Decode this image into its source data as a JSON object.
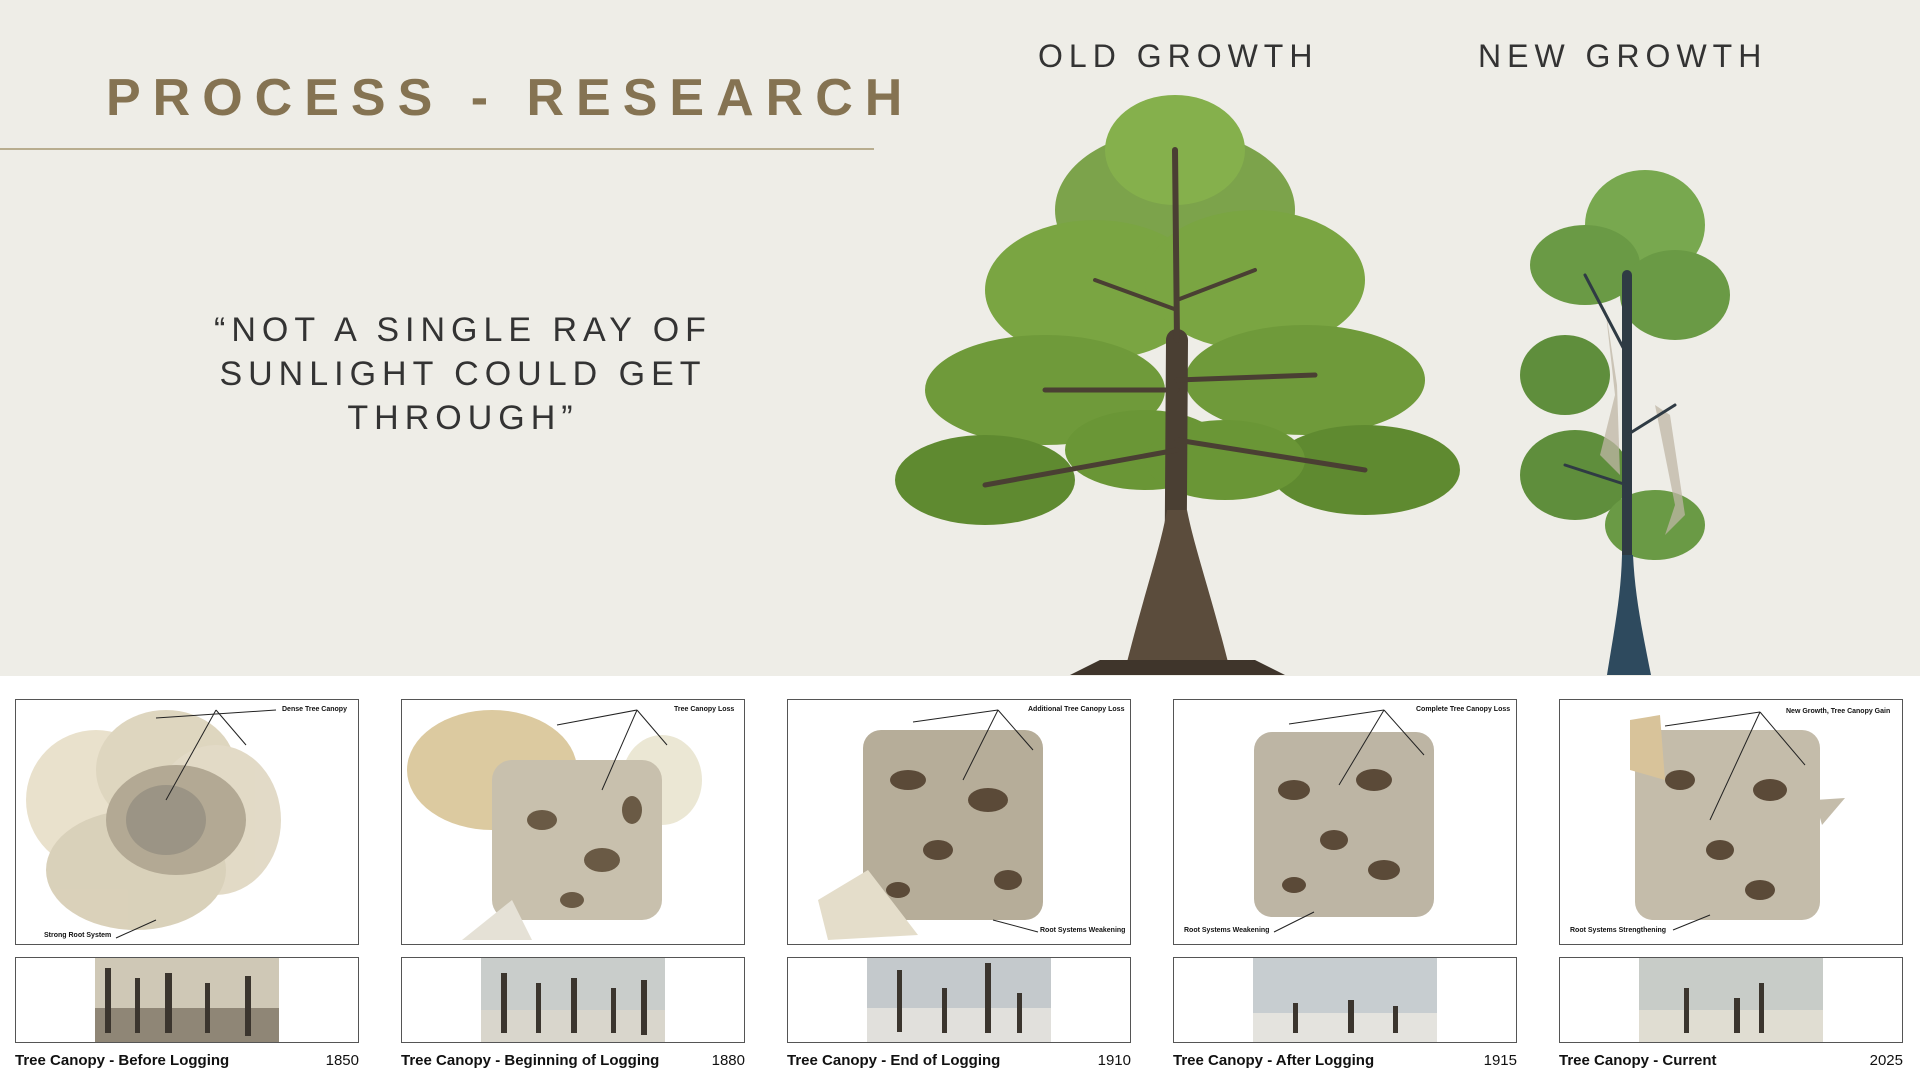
{
  "header": {
    "title": "PROCESS - RESEARCH"
  },
  "quote": {
    "lines": [
      "“NOT A SINGLE RAY OF",
      "SUNLIGHT COULD GET",
      "THROUGH”"
    ]
  },
  "trees": {
    "old_label": "OLD GROWTH",
    "new_label": "NEW GROWTH"
  },
  "panels": [
    {
      "top_note": "Dense Tree Canopy",
      "bottom_note": "Strong Root System",
      "caption": "Tree Canopy - Before Logging",
      "year": "1850"
    },
    {
      "top_note": "Tree Canopy Loss",
      "bottom_note": "",
      "caption": "Tree Canopy - Beginning of Logging",
      "year": "1880"
    },
    {
      "top_note": "Additional Tree Canopy Loss",
      "bottom_note": "Root Systems Weakening",
      "caption": "Tree Canopy - End of Logging",
      "year": "1910"
    },
    {
      "top_note": "Complete Tree Canopy Loss",
      "bottom_note": "Root Systems Weakening",
      "caption": "Tree Canopy - After Logging",
      "year": "1915"
    },
    {
      "top_note": "New Growth, Tree Canopy Gain",
      "bottom_note": "Root Systems Strengthening",
      "caption": "Tree Canopy - Current",
      "year": "2025"
    }
  ],
  "colors": {
    "title": "#857352",
    "background": "#eeede7",
    "foliage": "#6f9a3a",
    "trunk": "#4a3f33"
  }
}
